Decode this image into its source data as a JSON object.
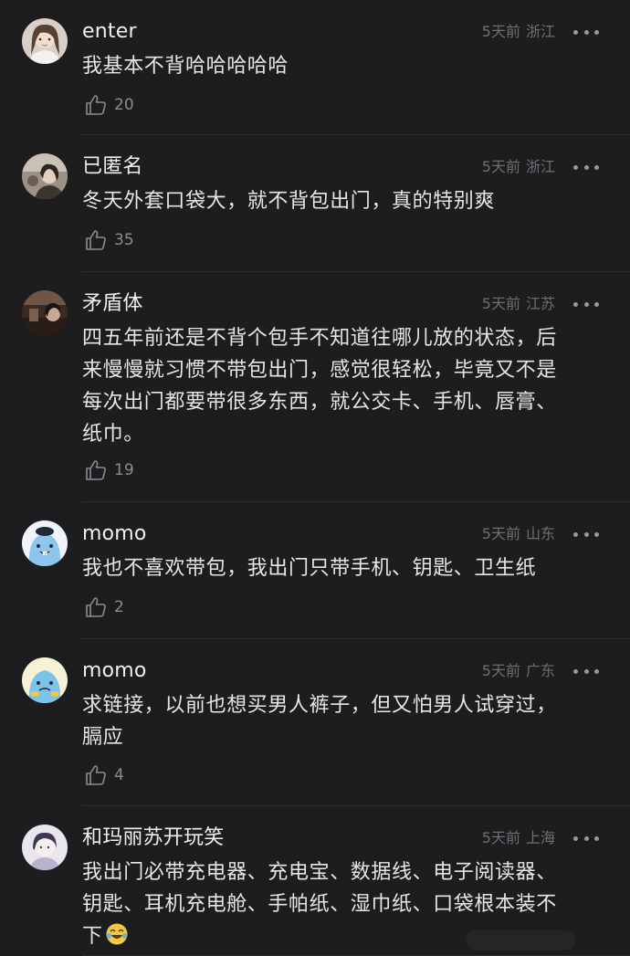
{
  "comments": [
    {
      "name": "enter",
      "time": "5天前",
      "region": "浙江",
      "text": "我基本不背哈哈哈哈哈",
      "likes": "20",
      "avatar_icon": "photo-girl-avatar"
    },
    {
      "name": "已匿名",
      "time": "5天前",
      "region": "浙江",
      "text": "冬天外套口袋大，就不背包出门，真的特别爽",
      "likes": "35",
      "avatar_icon": "photo-avatar"
    },
    {
      "name": "矛盾体",
      "time": "5天前",
      "region": "江苏",
      "text": "四五年前还是不背个包手不知道往哪儿放的状态，后\n来慢慢就习惯不带包出门，感觉很轻松，毕竟又不是\n每次出门都要带很多东西，就公交卡、手机、唇膏、\n纸巾。",
      "likes": "19",
      "avatar_icon": "photo-avatar"
    },
    {
      "name": "momo",
      "time": "5天前",
      "region": "山东",
      "text": "我也不喜欢带包，我出门只带手机、钥匙、卫生纸",
      "likes": "2",
      "avatar_icon": "cartoon-blob-avatar"
    },
    {
      "name": "momo",
      "time": "5天前",
      "region": "广东",
      "text": "求链接，以前也想买男人裤子，但又怕男人试穿过，\n膈应",
      "likes": "4",
      "avatar_icon": "cartoon-blob-avatar"
    },
    {
      "name": "和玛丽苏开玩笑",
      "time": "5天前",
      "region": "上海",
      "text": "我出门必带充电器、充电宝、数据线、电子阅读器、\n钥匙、耳机充电舱、手帕纸、湿巾纸、口袋根本装不\n下",
      "likes": "",
      "avatar_icon": "sketch-avatar",
      "emoji": "laughing-tears-emoji"
    }
  ],
  "icons": {
    "like": "thumbs-up-icon",
    "more": "more-dots-icon"
  },
  "colors": {
    "background": "#1d1d1f",
    "text": "#e6e6e6",
    "meta": "#6f6f73",
    "divider": "#2e2e31"
  }
}
